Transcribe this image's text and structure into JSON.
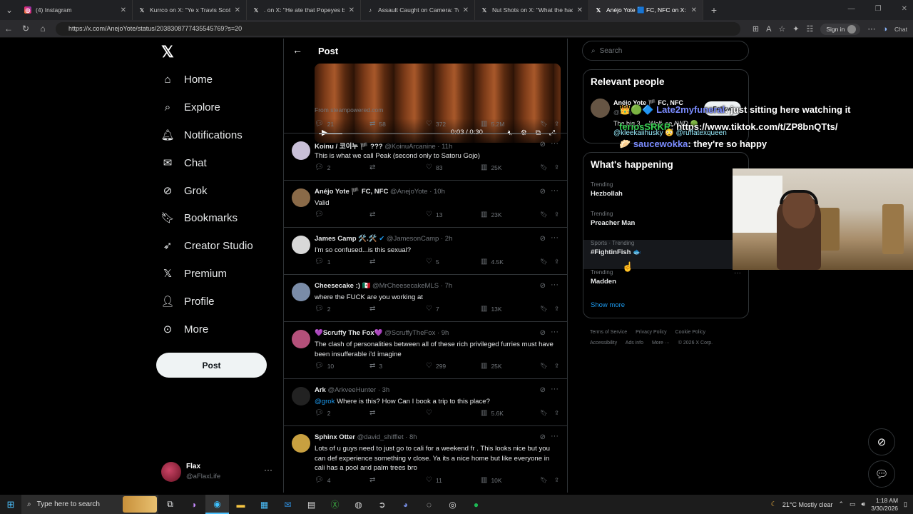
{
  "browser": {
    "tabs": [
      {
        "title": "(4) Instagram",
        "icon": "instagram-icon",
        "active": false
      },
      {
        "title": "Kurrco on X: \"Ye x Travis Scott 🇨🇳 “I",
        "icon": "x-logo-icon",
        "active": false
      },
      {
        "title": ". on X: \"He ate that Popeyes biscuit",
        "icon": "x-logo-icon",
        "active": false
      },
      {
        "title": "Assault Caught on Camera: Two W",
        "icon": "tiktok-icon",
        "active": false
      },
      {
        "title": "Nut Shots on X: \"What the hack is",
        "icon": "x-logo-icon",
        "active": false
      },
      {
        "title": "Anéjo Yote 🟦 FC, NFC on X: \"Phu",
        "icon": "x-logo-icon",
        "active": true
      }
    ],
    "url": "https://x.com/AnejoYote/status/2038308777435545769?s=20",
    "signin_label": "Sign in",
    "chat_label": "Chat"
  },
  "nav": {
    "items": [
      {
        "label": "Home",
        "icon": "home-icon"
      },
      {
        "label": "Explore",
        "icon": "search-icon"
      },
      {
        "label": "Notifications",
        "icon": "bell-icon"
      },
      {
        "label": "Chat",
        "icon": "mail-icon"
      },
      {
        "label": "Grok",
        "icon": "grok-icon"
      },
      {
        "label": "Bookmarks",
        "icon": "bookmark-icon"
      },
      {
        "label": "Creator Studio",
        "icon": "rocket-icon"
      },
      {
        "label": "Premium",
        "icon": "x-logo-icon"
      },
      {
        "label": "Profile",
        "icon": "person-icon"
      },
      {
        "label": "More",
        "icon": "more-circle-icon"
      }
    ],
    "post_label": "Post",
    "account": {
      "name": "Flax",
      "handle": "@aFlaxLife"
    }
  },
  "post": {
    "header": "Post",
    "video": {
      "time": "0:03 / 0:30",
      "progress": 0.1
    },
    "from": "From steampowered.com",
    "stats": {
      "replies": "21",
      "reposts": "58",
      "likes": "372",
      "views": "5.2M"
    }
  },
  "replies": [
    {
      "name": "Koinu / 코이누 🏴 ???",
      "handle": "@KoinuArcanine · 11h",
      "text": "This is what we call Peak (second only to Satoru Gojo)",
      "replies": "2",
      "reposts": "",
      "likes": "83",
      "views": "25K",
      "avatar": "#c9c0d8"
    },
    {
      "name": "Anéjo Yote 🏴 FC, NFC",
      "handle": "@AnejoYote · 10h",
      "text": "Valid",
      "replies": "",
      "reposts": "",
      "likes": "13",
      "views": "23K",
      "avatar": "#8a6a48"
    },
    {
      "name": "James Camp 🛠️.🛠️",
      "handle": "@JamesonCamp · 2h",
      "text": "I'm so confused...is this sexual?",
      "replies": "1",
      "reposts": "",
      "likes": "5",
      "views": "4.5K",
      "avatar": "#d8d8d8",
      "verified": true
    },
    {
      "name": "Cheesecake :) 🇲🇽",
      "handle": "@MrCheesecakeMLS · 7h",
      "text": "where the FUCK are you working at",
      "replies": "2",
      "reposts": "",
      "likes": "7",
      "views": "13K",
      "avatar": "#7a8ca8"
    },
    {
      "name": "💜Scruffy The Fox💜",
      "handle": "@ScruffyTheFox · 9h",
      "text": "The clash of personalities between all of these rich privileged furries must have been insufferable i'd imagine",
      "replies": "10",
      "reposts": "3",
      "likes": "299",
      "views": "25K",
      "avatar": "#b4507a"
    },
    {
      "name": "Ark",
      "handle": "@ArkveeHunter · 3h",
      "mention": "@grok",
      "text": "Where is this? How Can I book a trip to this place?",
      "replies": "2",
      "reposts": "",
      "likes": "",
      "views": "5.6K",
      "avatar": "#222"
    },
    {
      "name": "Sphinx Otter",
      "handle": "@david_shifflet · 8h",
      "text": "Lots of u guys need to just go to cali for a weekend fr . This looks nice but you can def experience something v close. Ya its a nice home but like everyone in cali has a pool and palm trees bro",
      "replies": "4",
      "reposts": "",
      "likes": "11",
      "views": "10K",
      "avatar": "#c8a040"
    }
  ],
  "sidebar": {
    "search_placeholder": "Search",
    "relevant": {
      "title": "Relevant people",
      "name": "Anéjo Yote 🏴 FC, NFC",
      "handle": "@Anej...",
      "bio": "The big 3 ... Wolf, se AWD 🟢",
      "follow_label": "Follow"
    },
    "happening": {
      "title": "What's happening",
      "trends": [
        {
          "context": "Trending",
          "name": "Hezbollah"
        },
        {
          "context": "Trending",
          "name": "Preacher Man"
        },
        {
          "context": "Sports · Trending",
          "name": "#FightinFish 🐟"
        },
        {
          "context": "Trending",
          "name": "Madden"
        }
      ],
      "show_more": "Show more"
    },
    "footer": [
      "Terms of Service",
      "Privacy Policy",
      "Cookie Policy",
      "Accessibility",
      "Ads info",
      "More ···",
      "© 2026 X Corp."
    ]
  },
  "chat_overlay": [
    {
      "user": "Late2myfuneral",
      "msg": "just sitting here watching it"
    },
    {
      "user": "feriosSRKR",
      "msg": "https://www.tiktok.com/t/ZP8bnQTts/"
    },
    {
      "user": "@kleekaiihusky",
      "msg": "@ruffatexqueen"
    },
    {
      "user": "saucewokka",
      "msg": "they're so happy"
    }
  ],
  "taskbar": {
    "search_placeholder": "Type here to search",
    "weather": "21°C  Mostly clear",
    "time": "1:18 AM",
    "date": "3/30/2026"
  }
}
